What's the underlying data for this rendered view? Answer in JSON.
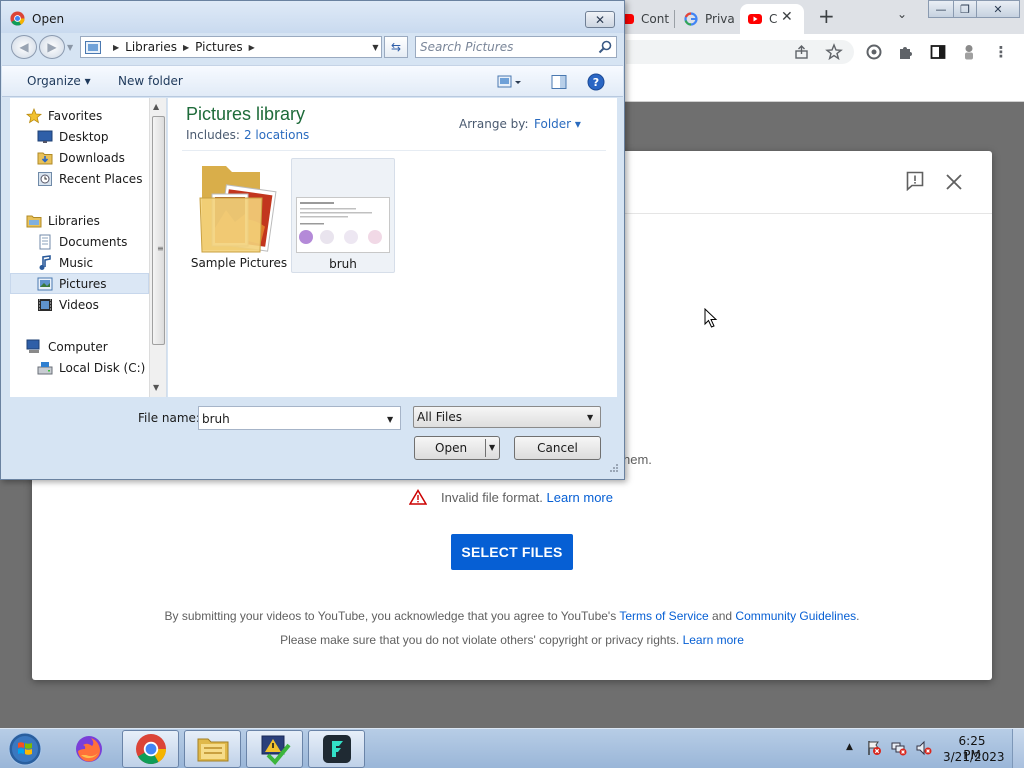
{
  "browser": {
    "tabs": [
      {
        "label": "Cont",
        "favicon": "youtube-red-icon"
      },
      {
        "label": "Priva",
        "favicon": "google-g-icon"
      },
      {
        "label": "C",
        "favicon": "youtube-icon",
        "active": true
      }
    ],
    "close_tab_glyph": "✕",
    "new_tab_glyph": "+",
    "tab_search_glyph": "⌄",
    "window_controls": {
      "minimize": "—",
      "maximize": "❐",
      "close": "✕"
    }
  },
  "youtube_modal": {
    "partial_text": "hem.",
    "error_text": "Invalid file format.",
    "error_link": "Learn more",
    "select_files_label": "SELECT FILES",
    "terms_prefix": "By submitting your videos to YouTube, you acknowledge that you agree to YouTube's ",
    "terms_link": "Terms of Service",
    "terms_and": " and ",
    "guidelines_link": "Community Guidelines",
    "terms_end": ".",
    "copyright_text": "Please make sure that you do not violate others' copyright or privacy rights. ",
    "copyright_link": "Learn more",
    "accent_color": "#065fd4"
  },
  "dialog": {
    "title": "Open",
    "close_glyph": "✕",
    "breadcrumb": [
      "Libraries",
      "Pictures"
    ],
    "search_placeholder": "Search Pictures",
    "organize_label": "Organize ▾",
    "new_folder_label": "New folder",
    "help_glyph": "?",
    "nav": {
      "favorites": {
        "label": "Favorites",
        "items": [
          "Desktop",
          "Downloads",
          "Recent Places"
        ]
      },
      "libraries": {
        "label": "Libraries",
        "items": [
          "Documents",
          "Music",
          "Pictures",
          "Videos"
        ],
        "selected": "Pictures"
      },
      "computer": {
        "label": "Computer",
        "items": [
          "Local Disk (C:)"
        ]
      }
    },
    "library": {
      "title": "Pictures library",
      "includes_label": "Includes:",
      "locations_link": "2 locations",
      "arrange_label": "Arrange by:",
      "arrange_value": "Folder ▾"
    },
    "files": [
      {
        "name": "Sample Pictures",
        "type": "folder"
      },
      {
        "name": "bruh",
        "type": "image"
      }
    ],
    "file_name_label": "File name:",
    "file_name_value": "bruh",
    "file_type_value": "All Files",
    "open_label": "Open",
    "cancel_label": "Cancel"
  },
  "taskbar": {
    "apps": [
      "firefox-icon",
      "chrome-icon",
      "file-explorer-icon",
      "security-check-icon",
      "filmora-icon"
    ],
    "active_app": "chrome-icon",
    "tray_up_glyph": "▲",
    "time": "6:25 PM",
    "date": "3/21/2023"
  }
}
